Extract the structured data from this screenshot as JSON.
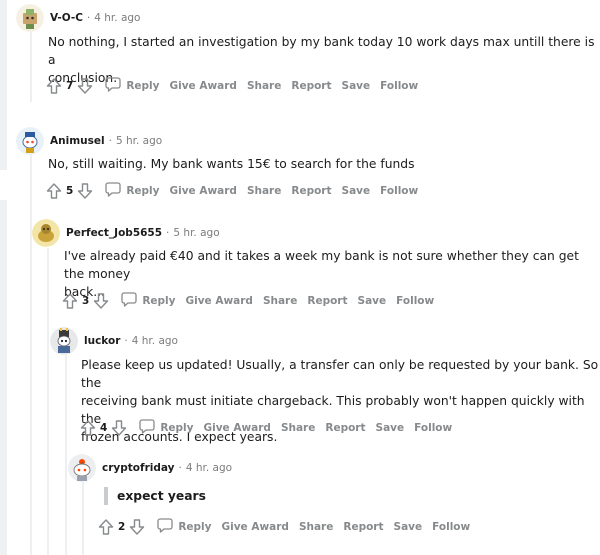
{
  "colors": {
    "meta": "#7c7c7c",
    "action": "#878a8c",
    "thread": "#edeff1",
    "quote_bar": "#c9cccf"
  },
  "comments": [
    {
      "author": "V-O-C",
      "separator": "·",
      "age": "4 hr. ago",
      "text_lines": [
        "No nothing, I started an investigation by my bank today 10 work days max untill there is a",
        "conclusion."
      ],
      "votes": "7",
      "actions": {
        "reply": "Reply",
        "award": "Give Award",
        "share": "Share",
        "report": "Report",
        "save": "Save",
        "follow": "Follow"
      },
      "avatar_icon": "snoo-avatar-icon"
    },
    {
      "author": "Animusel",
      "separator": "·",
      "age": "5 hr. ago",
      "text_lines": [
        "No, still waiting. My bank wants 15€ to search for the funds"
      ],
      "votes": "5",
      "actions": {
        "reply": "Reply",
        "award": "Give Award",
        "share": "Share",
        "report": "Report",
        "save": "Save",
        "follow": "Follow"
      },
      "avatar_icon": "snoo-avatar-icon"
    },
    {
      "author": "Perfect_Job5655",
      "separator": "·",
      "age": "5 hr. ago",
      "text_lines": [
        "I've already paid €40 and it takes a week my bank is not sure whether they can get the money",
        "back..."
      ],
      "votes": "3",
      "actions": {
        "reply": "Reply",
        "award": "Give Award",
        "share": "Share",
        "report": "Report",
        "save": "Save",
        "follow": "Follow"
      },
      "avatar_icon": "snoo-avatar-icon"
    },
    {
      "author": "luckor",
      "separator": "·",
      "age": "4 hr. ago",
      "text_lines": [
        "Please keep us updated! Usually, a transfer can only be requested by your bank. So the",
        "receiving bank must initiate chargeback. This probably won't happen quickly with the",
        "frozen accounts. I expect years."
      ],
      "votes": "4",
      "actions": {
        "reply": "Reply",
        "award": "Give Award",
        "share": "Share",
        "report": "Report",
        "save": "Save",
        "follow": "Follow"
      },
      "avatar_icon": "snoo-avatar-icon"
    },
    {
      "author": "cryptofriday",
      "separator": "·",
      "age": "4 hr. ago",
      "quote": "expect years",
      "votes": "2",
      "actions": {
        "reply": "Reply",
        "award": "Give Award",
        "share": "Share",
        "report": "Report",
        "save": "Save",
        "follow": "Follow"
      },
      "avatar_icon": "snoo-avatar-icon"
    }
  ]
}
